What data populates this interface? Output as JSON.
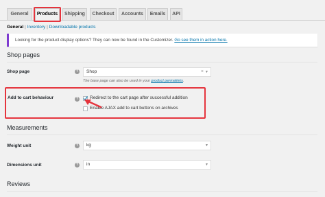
{
  "tabs": [
    "General",
    "Products",
    "Shipping",
    "Checkout",
    "Accounts",
    "Emails",
    "API"
  ],
  "subnav": {
    "current": "General",
    "sep": "|",
    "items": [
      "Inventory",
      "Downloadable products"
    ]
  },
  "notice": {
    "text": "Looking for the product display options? They can now be found in the Customizer.",
    "link": "Go see them in action here."
  },
  "sections": {
    "shop_pages": "Shop pages",
    "measurements": "Measurements",
    "reviews": "Reviews"
  },
  "shop_page": {
    "label": "Shop page",
    "value": "Shop",
    "desc_before": "The base page can also be used in your",
    "desc_link": "product permalinks",
    "desc_after": "."
  },
  "cart": {
    "label": "Add to cart behaviour",
    "opt1": {
      "label": "Redirect to the cart page after successful addition",
      "checked": true
    },
    "opt2": {
      "label": "Enable AJAX add to cart buttons on archives",
      "checked": false
    }
  },
  "weight": {
    "label": "Weight unit",
    "value": "kg"
  },
  "dimensions": {
    "label": "Dimensions unit",
    "value": "in"
  },
  "colors": {
    "highlight": "#e5343d",
    "link": "#0073aa",
    "notice_border": "#7e3bd0"
  },
  "icons": {
    "help": "?",
    "clear": "×",
    "dropdown": "▼",
    "check": "✓"
  }
}
